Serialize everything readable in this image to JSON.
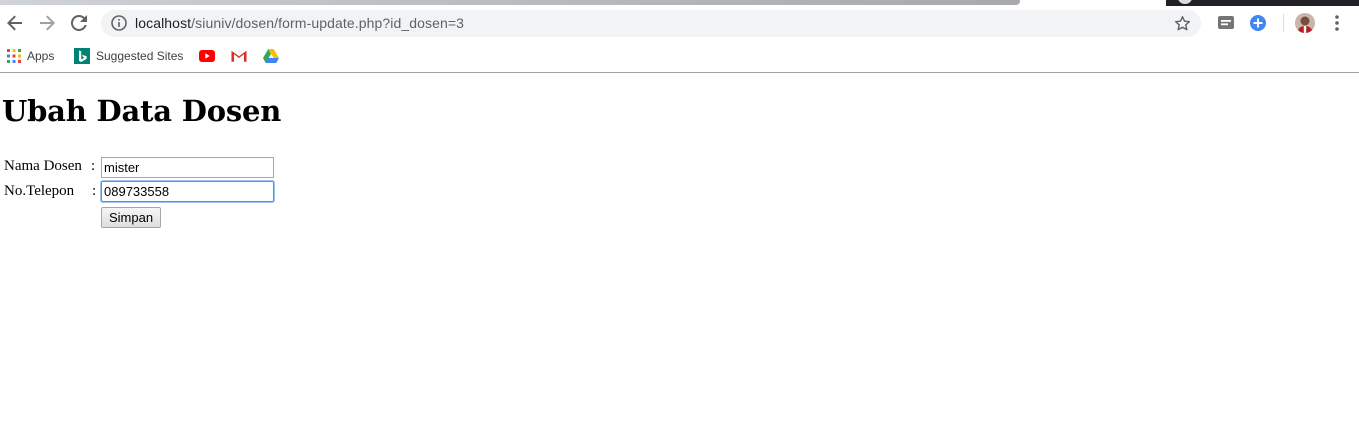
{
  "browser": {
    "url_host": "localhost",
    "url_path": "/siuniv/dosen/form-update.php?id_dosen=3",
    "icons": {
      "back": "back-arrow-icon",
      "forward": "forward-arrow-icon",
      "reload": "reload-icon",
      "info": "info-icon",
      "star": "star-icon",
      "menu": "more-vert-icon"
    }
  },
  "bookmarks": {
    "items": [
      {
        "label": "Apps",
        "icon": "apps-grid-icon"
      },
      {
        "label": "Suggested Sites",
        "icon": "bing-icon"
      },
      {
        "label": "",
        "icon": "youtube-icon"
      },
      {
        "label": "",
        "icon": "gmail-icon"
      },
      {
        "label": "",
        "icon": "google-drive-icon"
      }
    ]
  },
  "page": {
    "title": "Ubah Data Dosen",
    "form": {
      "nama_label": "Nama Dosen",
      "nama_colon": ":",
      "nama_value": "mister",
      "telepon_label": "No.Telepon",
      "telepon_colon": ":",
      "telepon_value": "089733558",
      "submit_label": "Simpan"
    }
  },
  "colors": {
    "focus_border": "#4d90fe",
    "omnibox_bg": "#f1f3f4"
  }
}
